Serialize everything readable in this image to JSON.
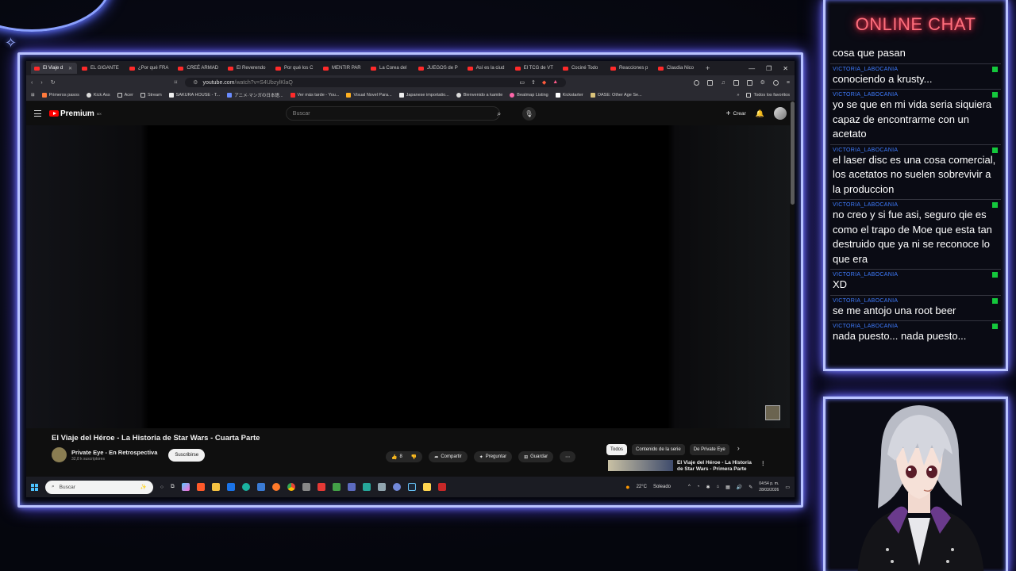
{
  "browser": {
    "tabs": [
      {
        "label": "El Viaje d",
        "active": true
      },
      {
        "label": "EL GIGANTE"
      },
      {
        "label": "¿Por qué FRA"
      },
      {
        "label": "CREÉ ARMAD"
      },
      {
        "label": "El Reverendo"
      },
      {
        "label": "Por qué los C"
      },
      {
        "label": "MENTIR PAR"
      },
      {
        "label": "La Corea del"
      },
      {
        "label": "JUEGOS de P"
      },
      {
        "label": "Así es la ciud"
      },
      {
        "label": "El TCG de VT"
      },
      {
        "label": "Cociné Todo"
      },
      {
        "label": "Reacciones p"
      },
      {
        "label": "Claudia Nico"
      }
    ],
    "new_tab": "+",
    "url_host": "youtube.com",
    "url_path": "/watch?v=S4UbzylKlaQ",
    "bookmarks": [
      "Primeros pasos",
      "Kick Ass",
      "Acer",
      "Stream",
      "SAKURA HOUSE - T...",
      "アニメ·マンガの日本語...",
      "Ver más tarde - You...",
      "Visual Novel Para...",
      "Japanese importatio...",
      "Bienvenido a kamite",
      "Beatmap Listing",
      "Kickstarter",
      "OASE: Other Age Se..."
    ],
    "bookmarks_more": "»",
    "all_bookmarks": "Todos los favoritos"
  },
  "youtube": {
    "logo": "Premium",
    "region": "MX",
    "search_placeholder": "Buscar",
    "create_label": "Crear",
    "video_title": "El Viaje del Héroe - La Historia de Star Wars - Cuarta Parte",
    "channel_name": "Private Eye - En Retrospectiva",
    "subscribers": "32,8 k suscriptores",
    "subscribe_label": "Suscribirse",
    "likes": "8",
    "share_label": "Compartir",
    "ask_label": "Preguntar",
    "save_label": "Guardar",
    "chips": [
      "Todos",
      "Contenido de la serie",
      "De Private Eye"
    ],
    "rec_title": "El Viaje del Héroe - La Historia de Star Wars - Primera Parte"
  },
  "taskbar": {
    "search_placeholder": "Buscar",
    "weather": "22°C",
    "weather_text": "Soleado",
    "time": "04:54 p. m.",
    "date": "28/03/2026"
  },
  "chat": {
    "title": "ONLINE CHAT",
    "messages": [
      {
        "user": "",
        "text": "cosa que pasan"
      },
      {
        "user": "VICTORIA_LABOCANIA",
        "text": "conociendo a krusty..."
      },
      {
        "user": "VICTORIA_LABOCANIA",
        "text": "yo se que en mi vida seria siquiera capaz de encontrarme con un acetato"
      },
      {
        "user": "VICTORIA_LABOCANIA",
        "text": "el laser disc es una cosa comercial, los acetatos no suelen sobrevivir a la produccion"
      },
      {
        "user": "VICTORIA_LABOCANIA",
        "text": "no creo y si fue asi, seguro qie es como el trapo de Moe que esta tan destruido que ya ni se reconoce lo que era"
      },
      {
        "user": "VICTORIA_LABOCANIA",
        "text": "XD"
      },
      {
        "user": "VICTORIA_LABOCANIA",
        "text": "se me antojo una root beer"
      },
      {
        "user": "VICTORIA_LABOCANIA",
        "text": "nada puesto... nada puesto..."
      }
    ]
  },
  "colors": {
    "neon": "#b9c3ff",
    "chat_title": "#ff6e7c",
    "username": "#3f7cff",
    "badge": "#14c83c"
  }
}
